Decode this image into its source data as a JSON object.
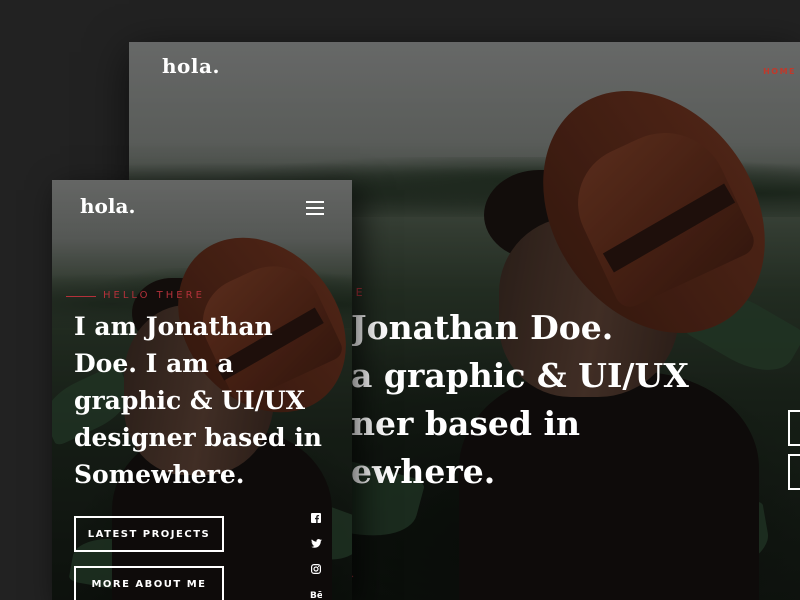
{
  "desktop": {
    "logo": "hola.",
    "nav_home": "HOME",
    "greeting": "THERE",
    "headline_lines": [
      "Jonathan Doe.",
      "a graphic & UI/UX",
      "ner based in",
      "ewhere."
    ]
  },
  "mobile": {
    "logo": "hola.",
    "greeting": "HELLO THERE",
    "headline_lines": [
      "I am Jonathan",
      "Doe. I am a",
      "graphic & UI/UX",
      "designer based in",
      "Somewhere."
    ],
    "buttons": {
      "latest_projects": "LATEST PROJECTS",
      "more_about_me": "MORE ABOUT ME"
    },
    "social_icons": [
      "facebook-icon",
      "twitter-icon",
      "instagram-icon",
      "behance-icon"
    ]
  },
  "colors": {
    "background": "#222222",
    "accent": "#b3313a",
    "text": "#ffffff"
  }
}
